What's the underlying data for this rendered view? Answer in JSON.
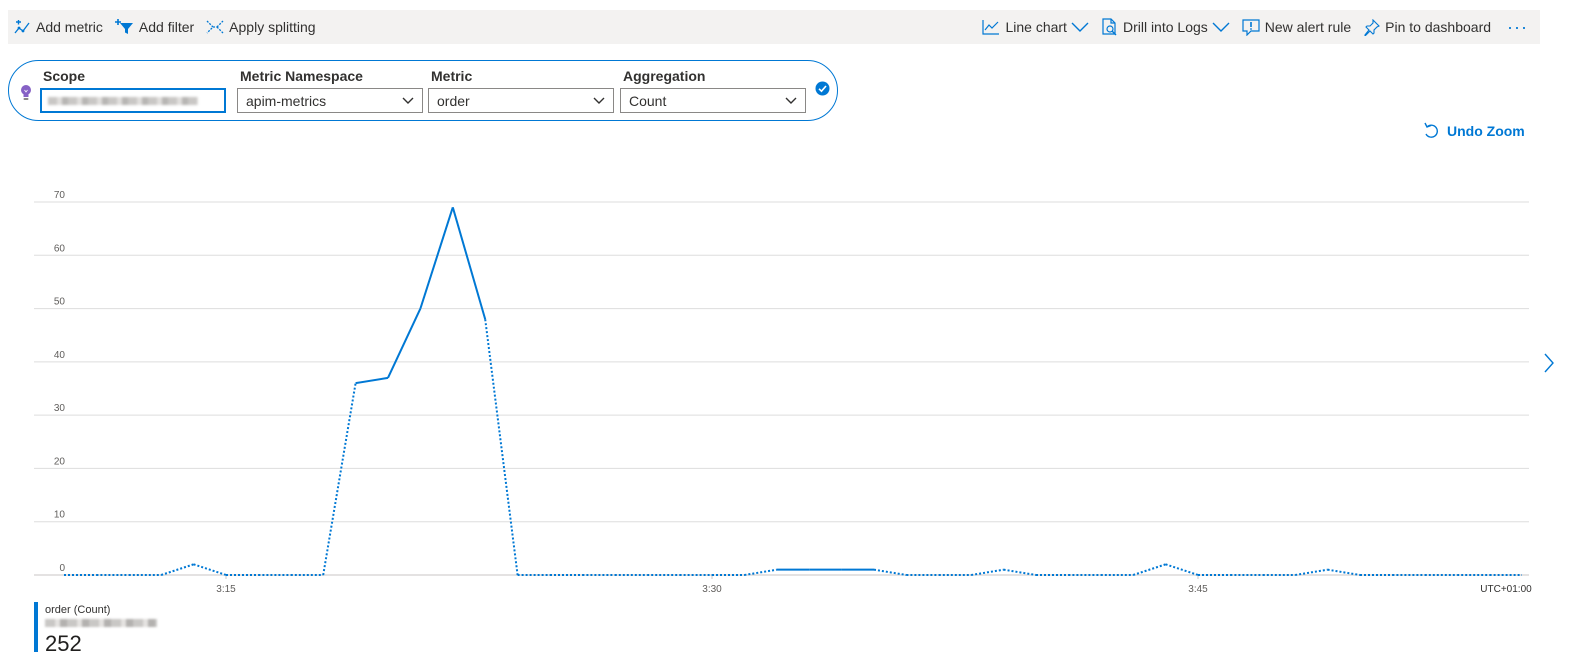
{
  "toolbar": {
    "left": [
      {
        "id": "add-metric",
        "label": "Add metric",
        "icon": "add-metric-icon"
      },
      {
        "id": "add-filter",
        "label": "Add filter",
        "icon": "add-filter-icon"
      },
      {
        "id": "apply-splitting",
        "label": "Apply splitting",
        "icon": "splitting-icon"
      }
    ],
    "right": [
      {
        "id": "line-chart",
        "label": "Line chart",
        "icon": "line-chart-icon",
        "dropdown": true
      },
      {
        "id": "drill-into-logs",
        "label": "Drill into Logs",
        "icon": "logs-icon",
        "dropdown": true
      },
      {
        "id": "new-alert-rule",
        "label": "New alert rule",
        "icon": "alert-icon"
      },
      {
        "id": "pin-to-dashboard",
        "label": "Pin to dashboard",
        "icon": "pin-icon"
      }
    ],
    "more": "···"
  },
  "metric_picker": {
    "scope": {
      "label": "Scope"
    },
    "namespace": {
      "label": "Metric Namespace",
      "value": "apim-metrics"
    },
    "metric": {
      "label": "Metric",
      "value": "order"
    },
    "aggregation": {
      "label": "Aggregation",
      "value": "Count"
    }
  },
  "undo_zoom": "Undo Zoom",
  "chart_data": {
    "type": "line",
    "x_ticks": [
      "3:15",
      "3:30",
      "3:45"
    ],
    "timezone_label": "UTC+01:00",
    "y_ticks": [
      0,
      10,
      20,
      30,
      40,
      50,
      60,
      70
    ],
    "ylim": [
      0,
      70
    ],
    "grid": true,
    "series": [
      {
        "name": "order (Count)",
        "color": "#0078d4",
        "x": [
          "3:10",
          "3:11",
          "3:12",
          "3:13",
          "3:14",
          "3:15",
          "3:16",
          "3:17",
          "3:18",
          "3:19",
          "3:20",
          "3:21",
          "3:22",
          "3:23",
          "3:24",
          "3:25",
          "3:26",
          "3:27",
          "3:28",
          "3:29",
          "3:30",
          "3:31",
          "3:32",
          "3:33",
          "3:34",
          "3:35",
          "3:36",
          "3:37",
          "3:38",
          "3:39",
          "3:40",
          "3:41",
          "3:42",
          "3:43",
          "3:44",
          "3:45",
          "3:46",
          "3:47",
          "3:48",
          "3:49",
          "3:50",
          "3:51",
          "3:52",
          "3:53",
          "3:54",
          "3:55"
        ],
        "values": [
          0,
          0,
          0,
          0,
          2,
          0,
          0,
          0,
          0,
          36,
          37,
          50,
          69,
          48,
          0,
          0,
          0,
          0,
          0,
          0,
          0,
          0,
          1,
          1,
          1,
          1,
          0,
          0,
          0,
          1,
          0,
          0,
          0,
          0,
          2,
          0,
          0,
          0,
          0,
          1,
          0,
          0,
          0,
          0,
          0,
          0
        ]
      }
    ]
  },
  "legend": {
    "name": "order (Count)",
    "value": "252"
  }
}
